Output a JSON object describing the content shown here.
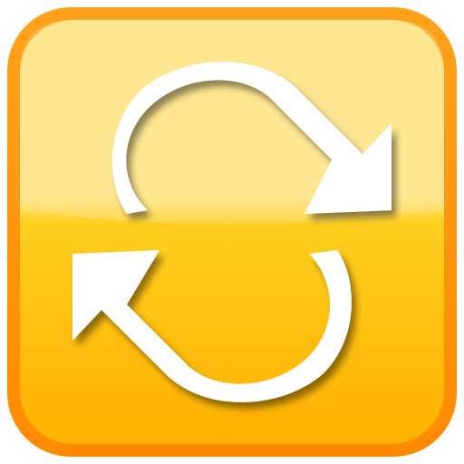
{
  "icon": {
    "name": "refresh-icon",
    "colors": {
      "border": "#FF8A00",
      "border_light": "#FFA21A",
      "face_top": "#FFE27A",
      "face_mid": "#FFCF1F",
      "face_bottom": "#FFB000",
      "arrow": "#FFFFFF",
      "shadow": "#7A4A00"
    }
  }
}
